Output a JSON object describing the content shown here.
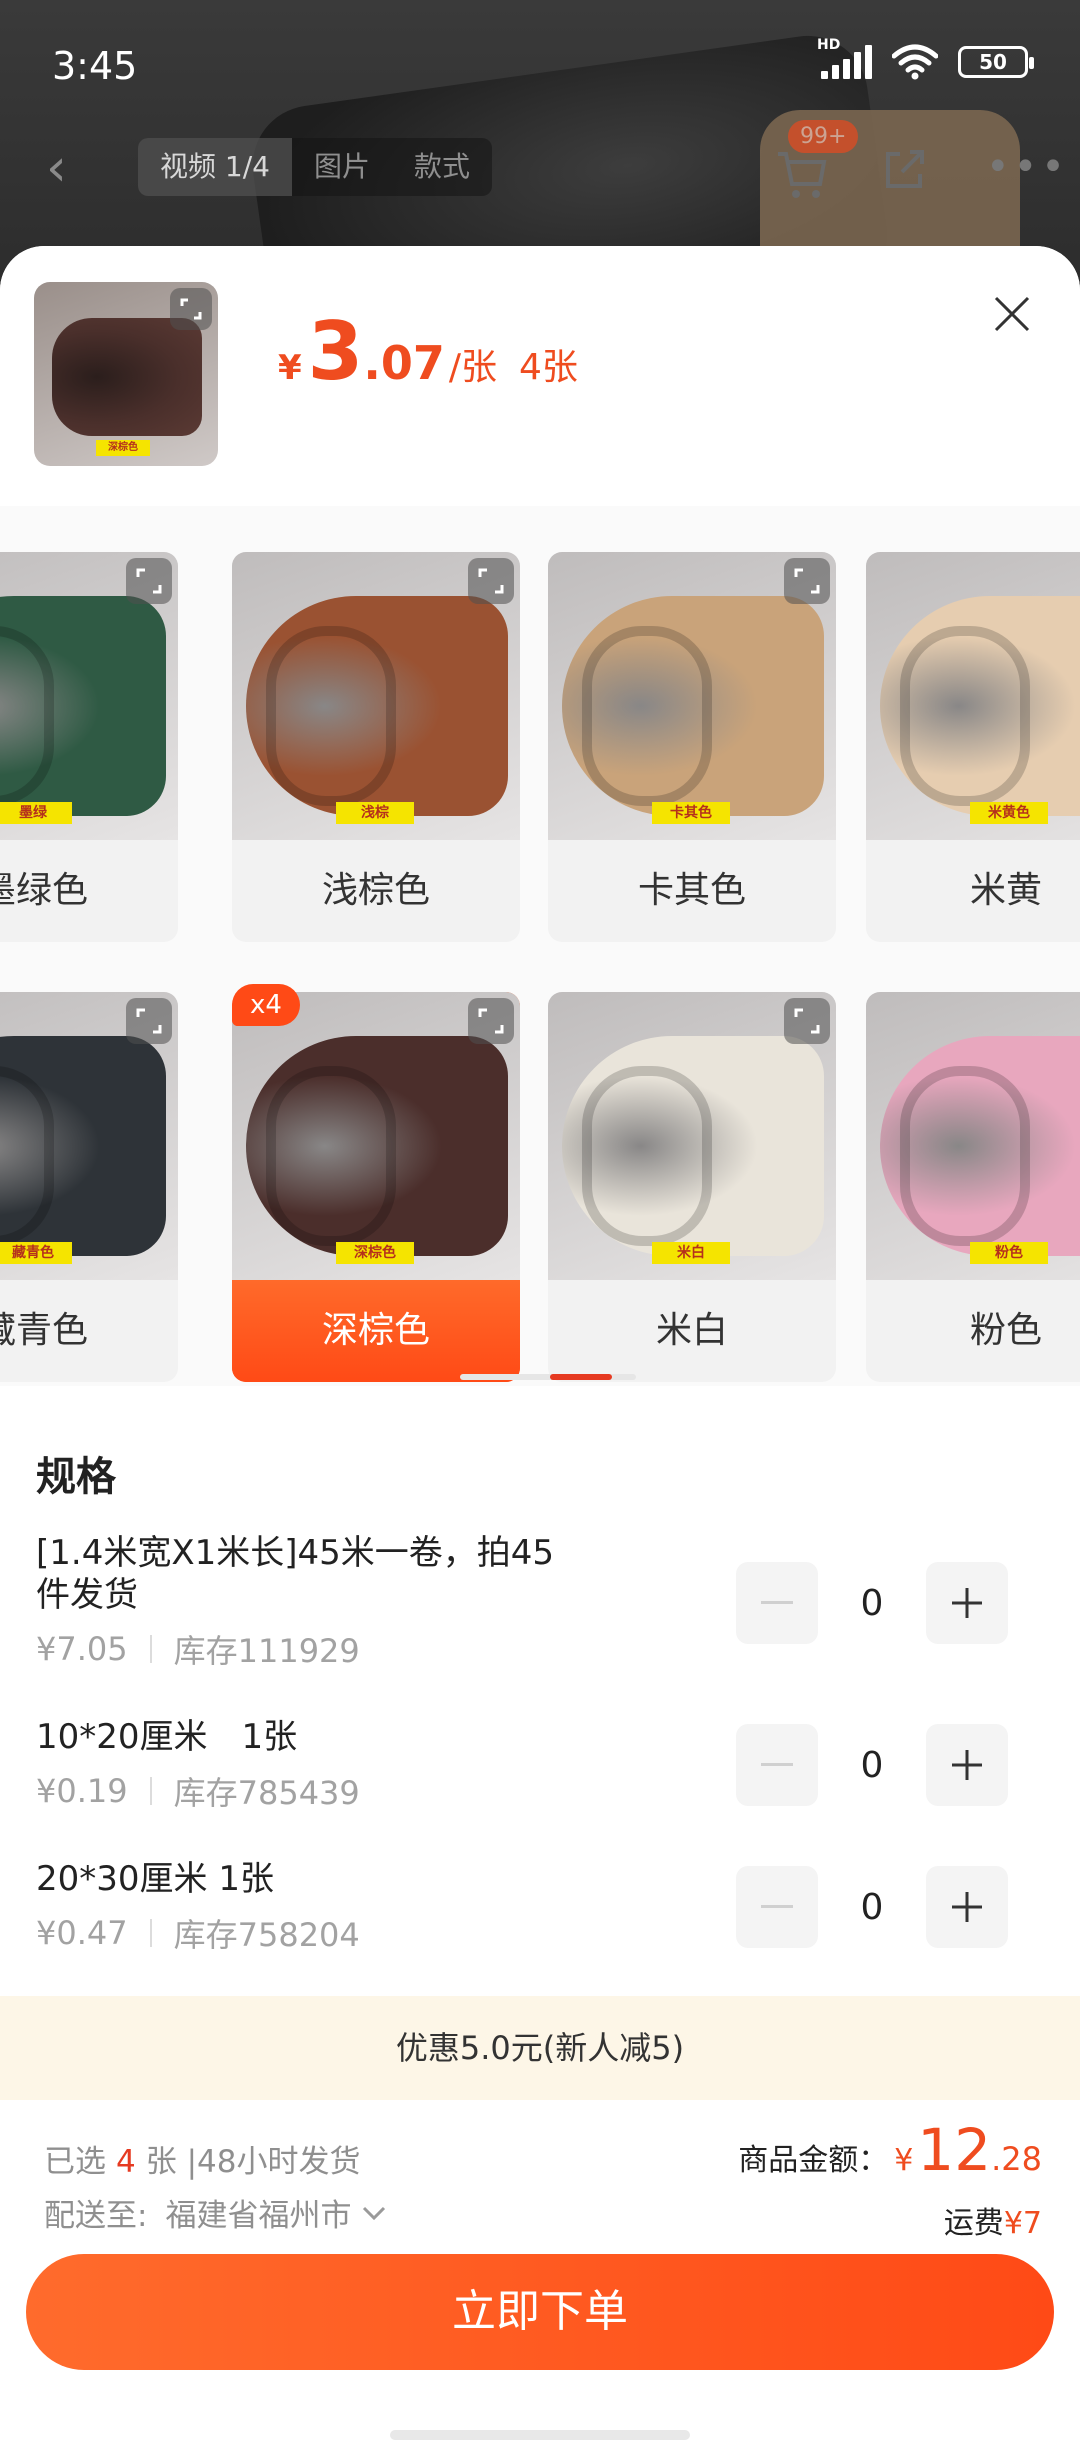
{
  "status_bar": {
    "time": "3:45",
    "network": "HD",
    "battery": "50"
  },
  "top_nav": {
    "media_tabs": [
      "视频 1/4",
      "图片",
      "款式"
    ],
    "cart_badge": "99+"
  },
  "header": {
    "currency": "¥",
    "price_int": "3",
    "price_dec": ".07",
    "price_unit": "/张",
    "selected_qty": "4张",
    "thumb_label": "深棕色"
  },
  "colors": [
    {
      "name": "墨绿色",
      "caption": "墨绿色",
      "tag": "墨绿",
      "swatch": "#2f5a44",
      "selected": false
    },
    {
      "name": "浅棕色",
      "caption": "浅棕色",
      "tag": "浅棕",
      "swatch": "#9a5232",
      "selected": false
    },
    {
      "name": "卡其色",
      "caption": "卡其色",
      "tag": "卡其色",
      "swatch": "#c9a37a",
      "selected": false
    },
    {
      "name": "米黄色",
      "caption": "米黄",
      "tag": "米黄色",
      "swatch": "#e6cdb0",
      "selected": false
    },
    {
      "name": "藏青色",
      "caption": "藏青色",
      "tag": "藏青色",
      "swatch": "#2e3338",
      "selected": false
    },
    {
      "name": "深棕色",
      "caption": "深棕色",
      "tag": "深棕色",
      "swatch": "#4b2e2b",
      "selected": true,
      "badge": "x4"
    },
    {
      "name": "米白",
      "caption": "米白",
      "tag": "米白",
      "swatch": "#e9e4da",
      "selected": false
    },
    {
      "name": "粉色",
      "caption": "粉色",
      "tag": "粉色",
      "swatch": "#e8a7be",
      "selected": false
    }
  ],
  "spec": {
    "title": "规格",
    "items": [
      {
        "name": "[1.4米宽X1米长]45米一卷，拍45件发货",
        "price": "¥7.05",
        "stock": "库存111929",
        "qty": "0"
      },
      {
        "name": "10*20厘米　1张",
        "price": "¥0.19",
        "stock": "库存785439",
        "qty": "0"
      },
      {
        "name": "20*30厘米  1张",
        "price": "¥0.47",
        "stock": "库存758204",
        "qty": "0"
      }
    ]
  },
  "promo": "优惠5.0元(新人减5)",
  "bottom": {
    "selected_prefix": "已选",
    "selected_count": "4",
    "selected_suffix": "张 |48小时发货",
    "ship_label": "配送至:",
    "ship_place": "福建省福州市",
    "total_label": "商品金额：",
    "total_currency": "¥",
    "total_int": "12",
    "total_dec": ".28",
    "freight_label": "运费",
    "freight_value": "¥7",
    "order_button": "立即下单"
  },
  "theme": {
    "accent": "#ff4a16",
    "price": "#ef4c1f",
    "promo_bg": "#fdf6e7"
  }
}
